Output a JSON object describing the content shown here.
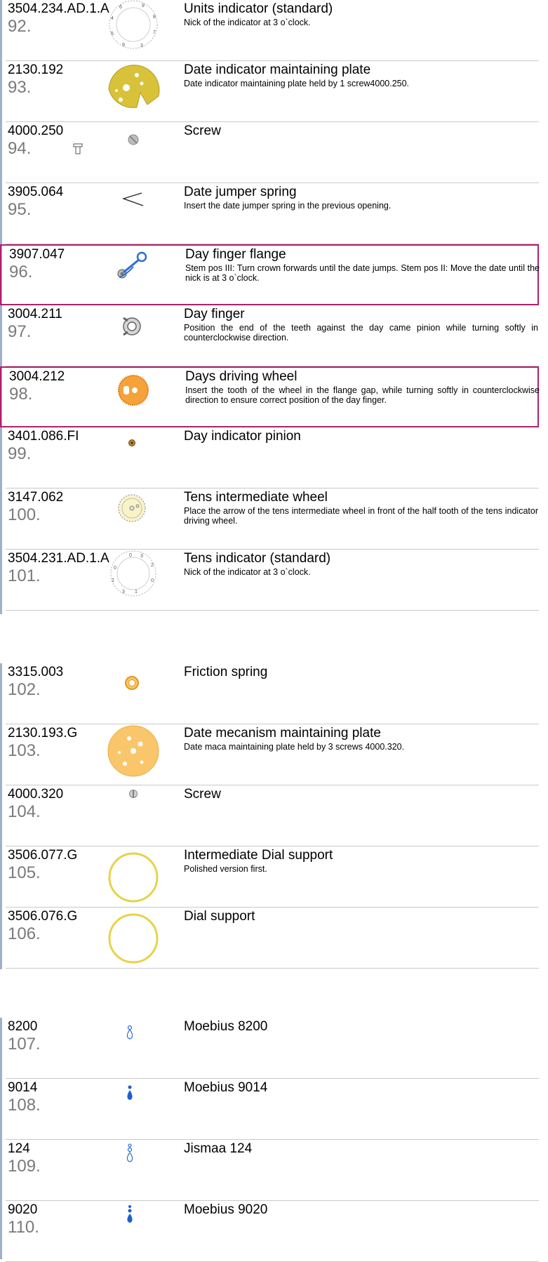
{
  "colors": {
    "highlight": "#b0206c",
    "sidebar": "#9fb0c9",
    "gold": "#d8b531",
    "orange": "#f5a23a",
    "blue": "#2b6fd4"
  },
  "groups": [
    {
      "rows": [
        {
          "ref": "3504.234.AD.1.A",
          "num": "92.",
          "title": "Units indicator (standard)",
          "desc": "Nick of the indicator at 3 o`clock.",
          "icon": "units-indicator-ring-icon"
        },
        {
          "ref": "2130.192",
          "num": "93.",
          "title": "Date indicator maintaining plate",
          "desc": "Date indicator maintaining plate held by 1 screw4000.250.",
          "icon": "gold-plate-icon"
        },
        {
          "ref": "4000.250",
          "num": "94.",
          "title": "Screw",
          "desc": "",
          "icon": "screw-icon"
        },
        {
          "ref": "3905.064",
          "num": "95.",
          "title": "Date jumper spring",
          "desc": "Insert the date jumper spring in the previous opening.",
          "icon": "spring-icon"
        },
        {
          "ref": "3907.047",
          "num": "96.",
          "title": "Day finger flange",
          "desc": "Stem pos III: Turn crown forwards until the date jumps. Stem pos II: Move the date  until the nick is at 3 o`clock.",
          "icon": "flange-icon",
          "highlight": true
        },
        {
          "ref": "3004.211",
          "num": "97.",
          "title": "Day finger",
          "desc": "Position the end of the teeth against the day came pinion while turning softly in counterclockwise direction.",
          "icon": "day-finger-icon"
        },
        {
          "ref": "3004.212",
          "num": "98.",
          "title": "Days driving wheel",
          "desc": "Insert the tooth of the wheel in the flange gap, while turning softly in counterclockwise direction to ensure correct position of the day finger.",
          "icon": "orange-wheel-icon",
          "highlight": true
        },
        {
          "ref": "3401.086.FI",
          "num": "99.",
          "title": "Day indicator pinion",
          "desc": "",
          "icon": "pinion-icon"
        },
        {
          "ref": "3147.062",
          "num": "100.",
          "title": "Tens intermediate wheel",
          "desc": "Place the arrow of the tens intermediate wheel in front of the half tooth of the tens indicator driving wheel.",
          "icon": "gear-wheel-icon"
        },
        {
          "ref": "3504.231.AD.1.A",
          "num": "101.",
          "title": "Tens indicator (standard)",
          "desc": "Nick of the indicator at 3 o`clock.",
          "icon": "tens-indicator-ring-icon"
        }
      ]
    },
    {
      "rows": [
        {
          "ref": "3315.003",
          "num": "102.",
          "title": "Friction spring",
          "desc": "",
          "icon": "friction-spring-icon"
        },
        {
          "ref": "2130.193.G",
          "num": "103.",
          "title": "Date mecanism maintaining plate",
          "desc": "Date maca maintaining plate held by 3 screws 4000.320.",
          "icon": "orange-plate-icon"
        },
        {
          "ref": "4000.320",
          "num": "104.",
          "title": "Screw",
          "desc": "",
          "icon": "screw-icon"
        },
        {
          "ref": "3506.077.G",
          "num": "105.",
          "title": "Intermediate Dial support",
          "desc": "Polished version first.",
          "icon": "dial-ring-icon"
        },
        {
          "ref": "3506.076.G",
          "num": "106.",
          "title": "Dial support",
          "desc": "",
          "icon": "dial-ring-icon"
        }
      ]
    },
    {
      "rows": [
        {
          "ref": "8200",
          "num": "107.",
          "title": "Moebius 8200",
          "desc": "",
          "icon": "oil-drop-outline-icon"
        },
        {
          "ref": "9014",
          "num": "108.",
          "title": "Moebius 9014",
          "desc": "",
          "icon": "oil-drop-filled-icon"
        },
        {
          "ref": "124",
          "num": "109.",
          "title": "Jismaa 124",
          "desc": "",
          "icon": "oil-drop-double-outline-icon"
        },
        {
          "ref": "9020",
          "num": "110.",
          "title": "Moebius 9020",
          "desc": "",
          "icon": "oil-drop-double-filled-icon"
        }
      ]
    }
  ]
}
